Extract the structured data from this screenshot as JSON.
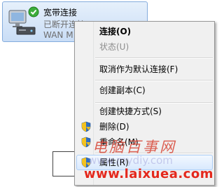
{
  "connection": {
    "name": "宽带连接",
    "status": "已断开连接",
    "device": "WAN M"
  },
  "context_menu": {
    "items": [
      {
        "label": "连接(O)",
        "bold": true,
        "disabled": false,
        "shield": false
      },
      {
        "label": "状态(U)",
        "bold": false,
        "disabled": true,
        "shield": false
      },
      {
        "label": "取消作为默认连接(F)",
        "bold": false,
        "disabled": false,
        "shield": false
      },
      {
        "label": "创建副本(C)",
        "bold": false,
        "disabled": false,
        "shield": false
      },
      {
        "label": "创建快捷方式(S)",
        "bold": false,
        "disabled": false,
        "shield": false
      },
      {
        "label": "删除(D)",
        "bold": false,
        "disabled": false,
        "shield": true
      },
      {
        "label": "重命名(M)",
        "bold": false,
        "disabled": false,
        "shield": true
      },
      {
        "label": "属性(R)",
        "bold": false,
        "disabled": false,
        "shield": true,
        "highlighted": true
      }
    ]
  },
  "watermark": {
    "site_name": "电脑百事网",
    "site_url_faint": "www.mydiy.com",
    "site_url": "www.laixuea.com"
  },
  "colors": {
    "selection_border": "#84acdd",
    "menu_background": "#f0f0f0",
    "watermark_red": "#e4281c"
  },
  "icons": {
    "connection": "network-connection-icon",
    "status": "green-check-icon",
    "uac": "uac-shield-icon"
  }
}
